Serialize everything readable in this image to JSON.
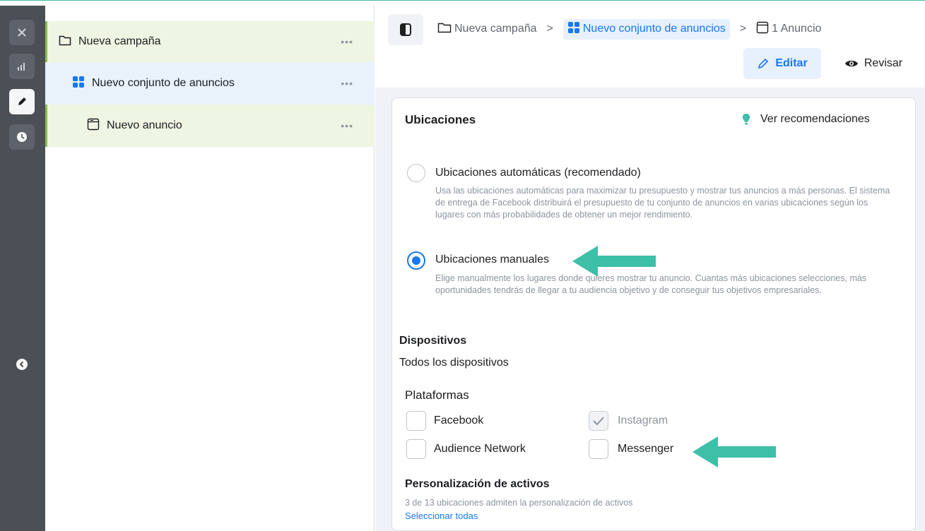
{
  "tree": {
    "campaign": {
      "label": "Nueva campaña",
      "menu": "•••"
    },
    "adset": {
      "label": "Nuevo conjunto de anuncios",
      "menu": "•••"
    },
    "ad": {
      "label": "Nuevo anuncio",
      "menu": "•••"
    }
  },
  "breadcrumb": {
    "campaign": "Nueva campaña",
    "adset": "Nuevo conjunto de anuncios",
    "ad": "1 Anuncio",
    "separator": ">"
  },
  "header": {
    "edit_label": "Editar",
    "review_label": "Revisar"
  },
  "placements": {
    "title": "Ubicaciones",
    "recommendations": "Ver recomendaciones",
    "auto": {
      "title": "Ubicaciones automáticas (recomendado)",
      "description": "Usa las ubicaciones automáticas para maximizar tu presupuesto y mostrar tus anuncios a más personas. El sistema de entrega de Facebook distribuirá el presupuesto de tu conjunto de anuncios en varias ubicaciones según los lugares con más probabilidades de obtener un mejor rendimiento.",
      "selected": false
    },
    "manual": {
      "title": "Ubicaciones manuales",
      "description": "Elige manualmente los lugares donde quieres mostrar tu anuncio. Cuantas más ubicaciones selecciones, más oportunidades tendrás de llegar a tu audiencia objetivo y de conseguir tus objetivos empresariales.",
      "selected": true
    }
  },
  "devices": {
    "title": "Dispositivos",
    "value": "Todos los dispositivos"
  },
  "platforms": {
    "title": "Plataformas",
    "items": [
      {
        "label": "Facebook",
        "checked": false
      },
      {
        "label": "Instagram",
        "checked": true
      },
      {
        "label": "Audience Network",
        "checked": false
      },
      {
        "label": "Messenger",
        "checked": false
      }
    ]
  },
  "asset_customization": {
    "title": "Personalización de activos",
    "description": "3 de 13 ubicaciones admiten la personalización de activos",
    "select_all": "Seleccionar todas"
  },
  "colors": {
    "accent_blue": "#1877f2",
    "arrow_teal": "#3dbfa8",
    "rail": "#4b4f56",
    "campaign_row": "#eef5e2",
    "adset_row": "#e9f1fb"
  },
  "icons": [
    "close-icon",
    "chart-icon",
    "pencil-icon",
    "clock-icon",
    "chevron-left-icon",
    "folder-icon",
    "grid-icon",
    "ad-icon",
    "panel-icon",
    "eye-icon",
    "lightbulb-icon",
    "checkmark-icon"
  ]
}
